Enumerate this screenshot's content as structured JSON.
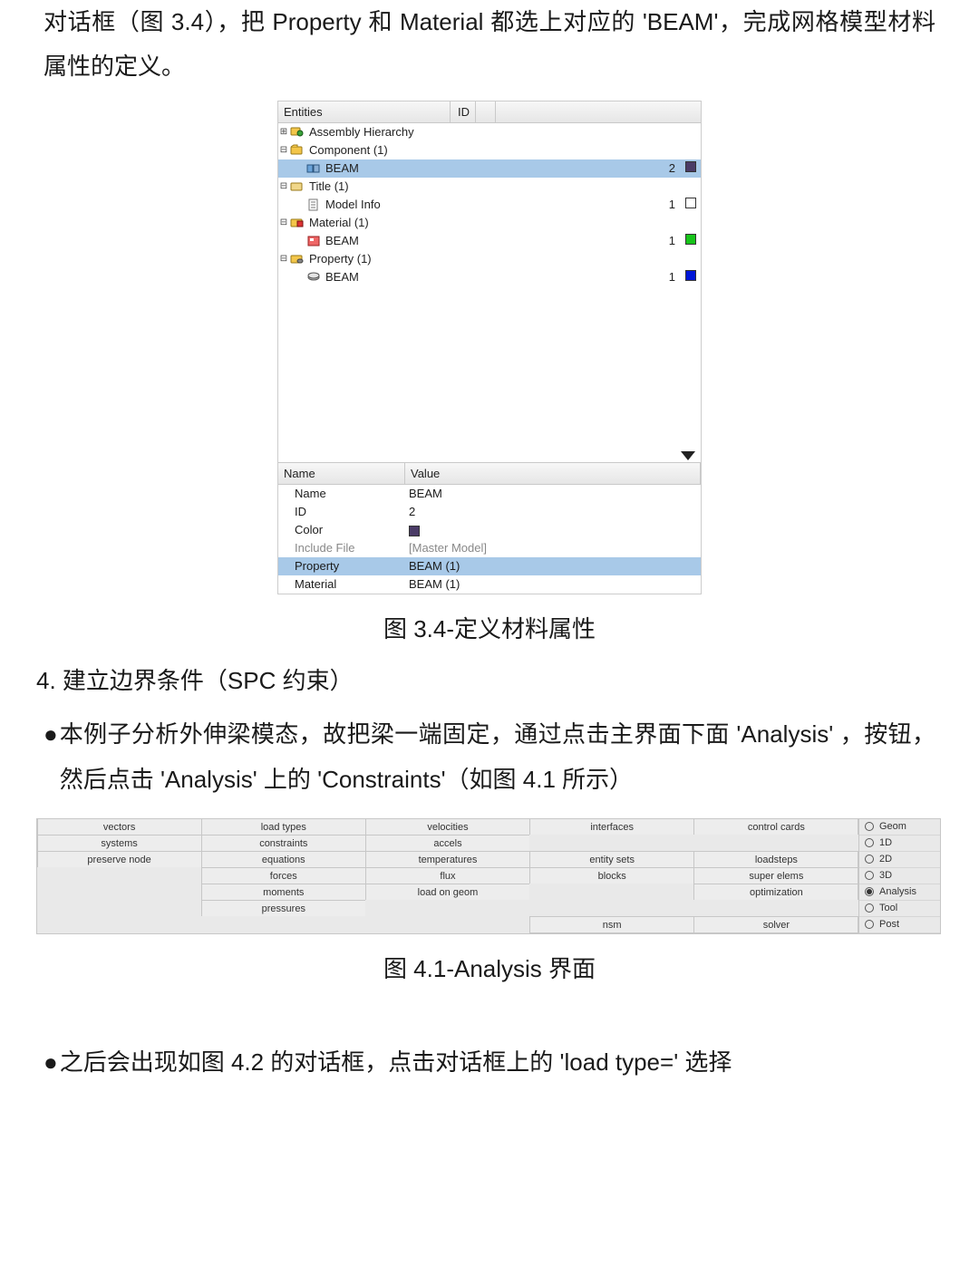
{
  "para1": "对话框（图 3.4），把 Property 和 Material 都选上对应的 'BEAM'，完成网格模型材料属性的定义。",
  "entities": {
    "header_entities": "Entities",
    "header_id": "ID",
    "rows": [
      {
        "tri": "plus",
        "indent": 0,
        "icon": "assembly",
        "label": "Assembly Hierarchy",
        "id": "",
        "swatch": "",
        "selected": false
      },
      {
        "tri": "minus",
        "indent": 0,
        "icon": "comp-folder",
        "label": "Component (1)",
        "id": "",
        "swatch": "",
        "selected": false
      },
      {
        "tri": "",
        "indent": 1,
        "icon": "comp",
        "label": "BEAM",
        "id": "2",
        "swatch": "#4a3b66",
        "selected": true
      },
      {
        "tri": "minus",
        "indent": 0,
        "icon": "title-folder",
        "label": "Title (1)",
        "id": "",
        "swatch": "",
        "selected": false
      },
      {
        "tri": "",
        "indent": 1,
        "icon": "note",
        "label": "Model Info",
        "id": "1",
        "swatch": "#ffffff",
        "selected": false
      },
      {
        "tri": "minus",
        "indent": 0,
        "icon": "mat-folder",
        "label": "Material (1)",
        "id": "",
        "swatch": "",
        "selected": false
      },
      {
        "tri": "",
        "indent": 1,
        "icon": "mat",
        "label": "BEAM",
        "id": "1",
        "swatch": "#17c41a",
        "selected": false
      },
      {
        "tri": "minus",
        "indent": 0,
        "icon": "prop-folder",
        "label": "Property (1)",
        "id": "",
        "swatch": "",
        "selected": false
      },
      {
        "tri": "",
        "indent": 1,
        "icon": "prop",
        "label": "BEAM",
        "id": "1",
        "swatch": "#0016d8",
        "selected": false
      }
    ]
  },
  "pv": {
    "header_name": "Name",
    "header_value": "Value",
    "rows": [
      {
        "name": "Name",
        "value": "BEAM",
        "selected": false,
        "dim": false,
        "swatch": ""
      },
      {
        "name": "ID",
        "value": "2",
        "selected": false,
        "dim": false,
        "swatch": ""
      },
      {
        "name": "Color",
        "value": "",
        "selected": false,
        "dim": false,
        "swatch": "#4a3b66"
      },
      {
        "name": "Include File",
        "value": "[Master Model]",
        "selected": false,
        "dim": true,
        "swatch": ""
      },
      {
        "name": "Property",
        "value": "BEAM (1)",
        "selected": true,
        "dim": false,
        "swatch": ""
      },
      {
        "name": "Material",
        "value": "BEAM (1)",
        "selected": false,
        "dim": false,
        "swatch": ""
      }
    ]
  },
  "fig34_caption": "图 3.4-定义材料属性",
  "heading4": "4. 建立边界条件（SPC 约束）",
  "bullet1": "本例子分析外伸梁模态，故把梁一端固定，通过点击主界面下面 'Analysis' ，按钮，然后点击 'Analysis' 上的 'Constraints'（如图 4.1 所示）",
  "toolbar": {
    "cells": [
      [
        "vectors",
        "load types",
        "velocities",
        "interfaces",
        "control cards"
      ],
      [
        "systems",
        "constraints",
        "accels",
        "",
        ""
      ],
      [
        "preserve node",
        "equations",
        "temperatures",
        "entity sets",
        "loadsteps"
      ],
      [
        "",
        "forces",
        "flux",
        "blocks",
        "super elems"
      ],
      [
        "",
        "moments",
        "load on geom",
        "",
        "optimization"
      ],
      [
        "",
        "pressures",
        "",
        "",
        ""
      ],
      [
        "",
        "",
        "",
        "nsm",
        "solver"
      ]
    ],
    "radios": [
      {
        "label": "Geom",
        "on": false
      },
      {
        "label": "1D",
        "on": false
      },
      {
        "label": "2D",
        "on": false
      },
      {
        "label": "3D",
        "on": false
      },
      {
        "label": "Analysis",
        "on": true
      },
      {
        "label": "Tool",
        "on": false
      },
      {
        "label": "Post",
        "on": false
      }
    ]
  },
  "fig41_caption": "图 4.1-Analysis 界面",
  "bullet2": "之后会出现如图 4.2 的对话框，点击对话框上的 'load type=' 选择"
}
